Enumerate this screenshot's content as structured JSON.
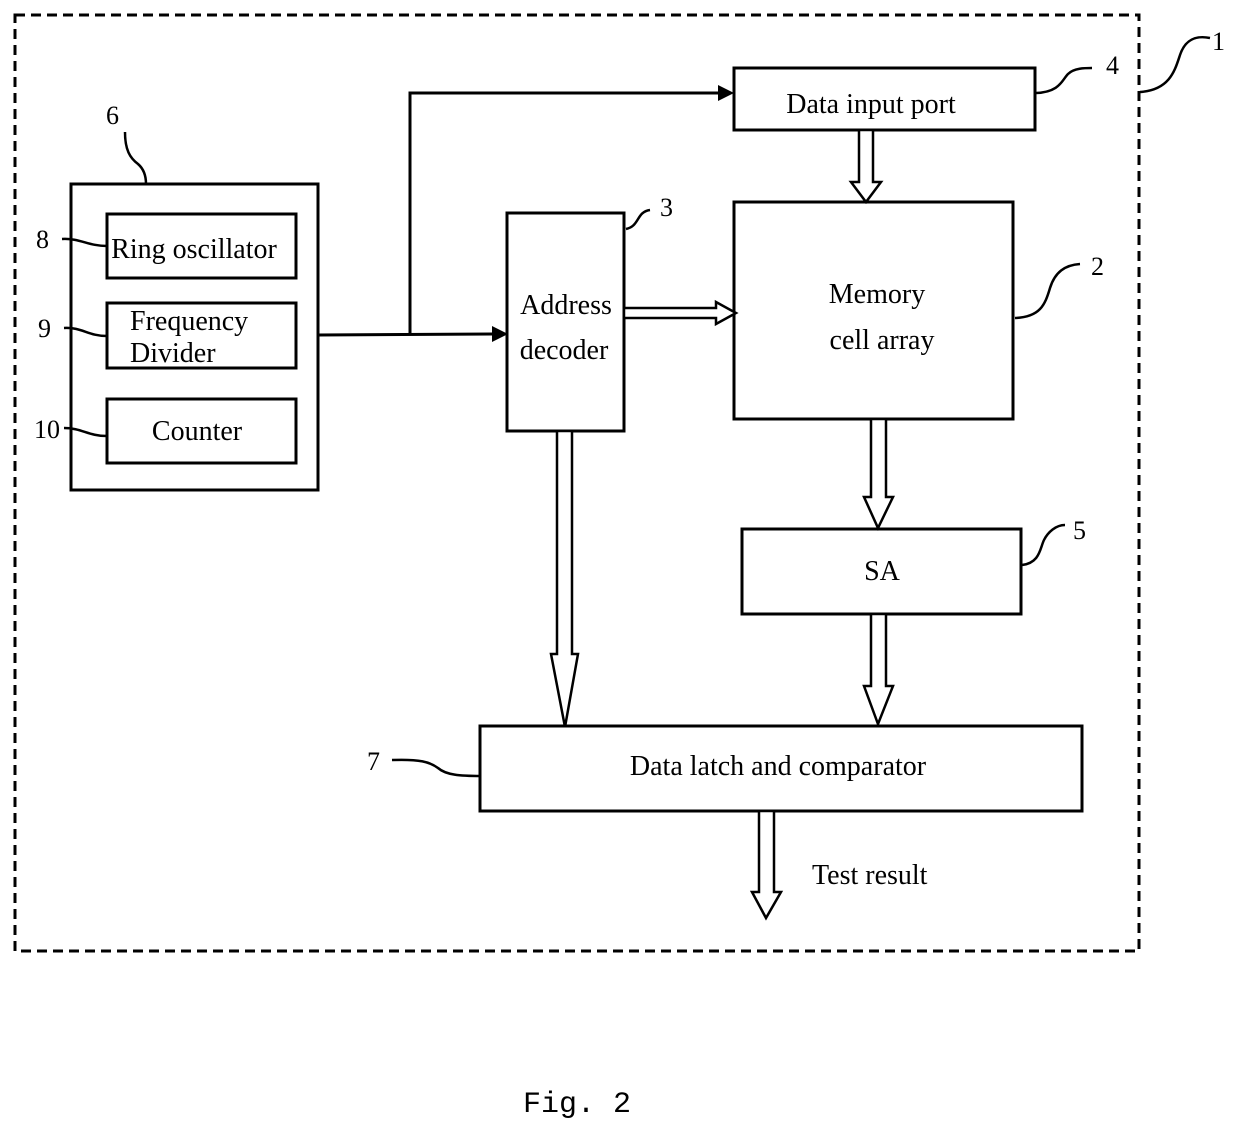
{
  "figure": {
    "caption": "Fig. 2",
    "outer_label": "1",
    "blocks": {
      "clock_unit": {
        "ref": "6"
      },
      "ring_oscillator": {
        "label": "Ring oscillator",
        "ref": "8"
      },
      "frequency_divider": {
        "label_line1": "Frequency",
        "label_line2": "Divider",
        "ref": "9"
      },
      "counter": {
        "label": "Counter",
        "ref": "10"
      },
      "address_decoder": {
        "label_line1": "Address",
        "label_line2": "decoder",
        "ref": "3"
      },
      "data_input_port": {
        "label": "Data input port",
        "ref": "4"
      },
      "memory_cell_array": {
        "label_line1": "Memory",
        "label_line2": "cell array",
        "ref": "2"
      },
      "sense_amplifier": {
        "label": "SA",
        "ref": "5"
      },
      "data_latch_comparator": {
        "label": "Data latch and comparator",
        "ref": "7"
      }
    },
    "output_label": "Test result"
  }
}
